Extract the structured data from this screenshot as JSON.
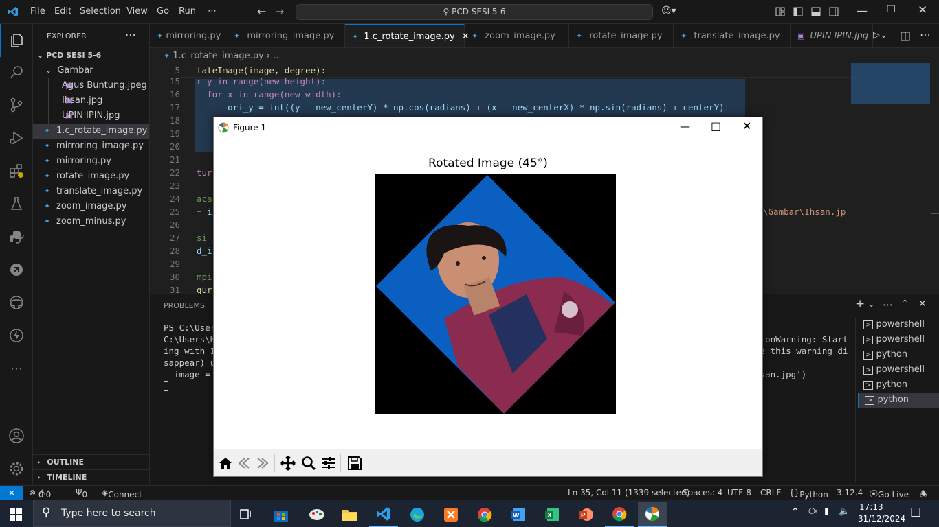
{
  "titlebar": {
    "menus": [
      "File",
      "Edit",
      "Selection",
      "View",
      "Go",
      "Run",
      "⋯"
    ],
    "search_text": "PCD SESI 5-6"
  },
  "sidebar": {
    "header": "EXPLORER",
    "project": "PCD SESI 5-6",
    "folder": "Gambar",
    "folder_files": [
      "Agus Buntung.jpeg",
      "Ihsan.jpg",
      "UPIN IPIN.jpg"
    ],
    "files": [
      "1.c_rotate_image.py",
      "mirroring_image.py",
      "mirroring.py",
      "rotate_image.py",
      "translate_image.py",
      "zoom_image.py",
      "zoom_minus.py"
    ],
    "outline": "OUTLINE",
    "timeline": "TIMELINE"
  },
  "tabs": [
    {
      "label": "mirroring.py"
    },
    {
      "label": "mirroring_image.py"
    },
    {
      "label": "1.c_rotate_image.py"
    },
    {
      "label": "zoom_image.py"
    },
    {
      "label": "rotate_image.py"
    },
    {
      "label": "translate_image.py"
    },
    {
      "label": "UPIN IPIN.jpg"
    }
  ],
  "breadcrumb": {
    "file": "1.c_rotate_image.py",
    "rest": "..."
  },
  "editor": {
    "lines": [
      {
        "n": "5",
        "code": "tateImage(image, degree):"
      },
      {
        "n": "15",
        "code": "r y in range(new_height):"
      },
      {
        "n": "16",
        "code": "  for x in range(new_width):"
      },
      {
        "n": "17",
        "code": "      ori_y = int((y - new_centerY) * np.cos(radians) + (x - new_centerX) * np.sin(radians) + centerY)"
      },
      {
        "n": "18",
        "code": ""
      },
      {
        "n": "19",
        "code": ""
      },
      {
        "n": "20",
        "code": ""
      },
      {
        "n": "21",
        "code": ""
      },
      {
        "n": "22",
        "code": "tur"
      },
      {
        "n": "23",
        "code": ""
      },
      {
        "n": "24",
        "code": "aca"
      },
      {
        "n": "25",
        "code": "= i"
      },
      {
        "n": "26",
        "code": ""
      },
      {
        "n": "27",
        "code": "si"
      },
      {
        "n": "28",
        "code": "d_i"
      },
      {
        "n": "29",
        "code": ""
      },
      {
        "n": "30",
        "code": "mpi"
      },
      {
        "n": "31",
        "code": "gur"
      }
    ],
    "path_fragment": "\\Gambar\\Ihsan.jp"
  },
  "panel": {
    "tab": "PROBLEMS",
    "terminal_lines": [
      "PS C:\\Users",
      "C:\\Users\\H",
      "ing with I",
      "sappear) u",
      "  image = "
    ],
    "terminal_right": [
      "tionWarning: Start",
      "ke this warning di",
      "",
      "hsan.jpg')"
    ],
    "terminals": [
      "powershell",
      "powershell",
      "python",
      "powershell",
      "python",
      "python"
    ]
  },
  "statusbar": {
    "errors": "0",
    "warnings": "0",
    "ports": "0",
    "connect": "Connect",
    "position": "Ln 35, Col 11 (1339 selected)",
    "spaces": "Spaces: 4",
    "encoding": "UTF-8",
    "eol": "CRLF",
    "language": "Python",
    "version": "3.12.4",
    "golive": "Go Live"
  },
  "figure": {
    "window_title": "Figure 1",
    "plot_title": "Rotated Image (45°)"
  },
  "taskbar": {
    "search_placeholder": "Type here to search",
    "time": "17:13",
    "date": "31/12/2024"
  },
  "colors": {
    "accent": "#0078d4",
    "photo_blue": "#0b5fc0"
  }
}
